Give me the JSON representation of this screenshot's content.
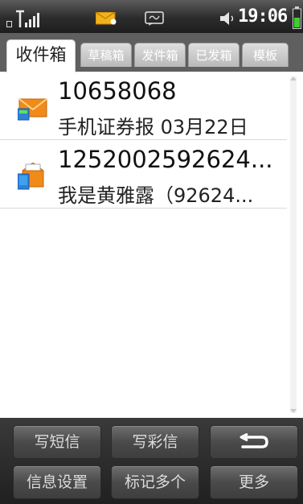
{
  "status_bar": {
    "time": "19:06",
    "icons": [
      "network-type-icon",
      "signal-strength-icon",
      "new-mail-icon",
      "sms-icon",
      "volume-icon",
      "battery-icon"
    ]
  },
  "tabs": [
    {
      "label": "收件箱",
      "active": true
    },
    {
      "label": "草稿箱",
      "active": false
    },
    {
      "label": "发件箱",
      "active": false
    },
    {
      "label": "已发箱",
      "active": false
    },
    {
      "label": "模板",
      "active": false
    }
  ],
  "messages": [
    {
      "sender": "10658068",
      "preview": "手机证券报 03月22日",
      "icon": "unread-message-envelope-icon"
    },
    {
      "sender": "1252002592624...",
      "preview": "我是黄雅露（92624...",
      "icon": "mms-envelope-icon"
    }
  ],
  "toolbar": {
    "write_sms": "写短信",
    "write_mms": "写彩信",
    "back_icon": "back-arrow-icon",
    "settings": "信息设置",
    "mark_multiple": "标记多个",
    "more": "更多"
  },
  "colors": {
    "status_bar_bg": "#2c2c2c",
    "tab_strip_bg": "#5f5f5f",
    "toolbar_bg": "#2a2a2a",
    "envelope_orange": "#f08a18"
  }
}
